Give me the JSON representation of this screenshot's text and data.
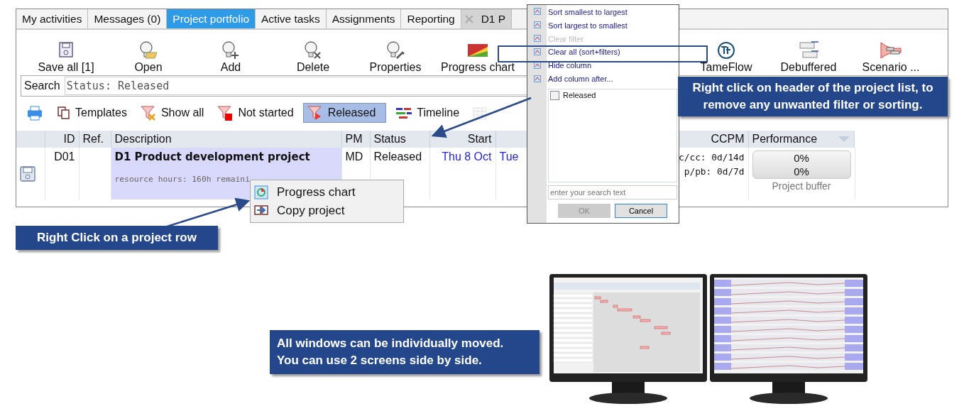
{
  "tabs": [
    {
      "label": "My activities",
      "selected": false,
      "closable": false
    },
    {
      "label": "Messages (0)",
      "selected": false,
      "closable": false
    },
    {
      "label": "Project portfolio",
      "selected": true,
      "closable": false
    },
    {
      "label": "Active tasks",
      "selected": false,
      "closable": false
    },
    {
      "label": "Assignments",
      "selected": false,
      "closable": false
    },
    {
      "label": "Reporting",
      "selected": false,
      "closable": false
    },
    {
      "label": "D1 P",
      "selected": false,
      "closable": true
    }
  ],
  "toolbar": {
    "left": [
      {
        "label": "Save all [1]",
        "kind": "save"
      },
      {
        "label": "Open",
        "kind": "open"
      },
      {
        "label": "Add",
        "kind": "add"
      },
      {
        "label": "Delete",
        "kind": "delete"
      },
      {
        "label": "Properties",
        "kind": "properties"
      },
      {
        "label": "Progress chart",
        "kind": "progress"
      }
    ],
    "right": [
      {
        "label": "TameFlow",
        "kind": "tameflow"
      },
      {
        "label": "Debuffered",
        "kind": "debuffered"
      },
      {
        "label": "Scenario ...",
        "kind": "scenario"
      }
    ]
  },
  "search": {
    "label": "Search",
    "value": "Status: Released"
  },
  "filters": [
    {
      "kind": "print",
      "selected": false,
      "disabled": false
    },
    {
      "kind": "templates",
      "label": "Templates",
      "selected": false,
      "disabled": false
    },
    {
      "kind": "show_all",
      "label": "Show all",
      "selected": false,
      "disabled": false
    },
    {
      "kind": "not_started",
      "label": "Not started",
      "selected": false,
      "disabled": false
    },
    {
      "kind": "released",
      "label": "Released",
      "selected": true,
      "disabled": false
    },
    {
      "kind": "timeline",
      "label": "Timeline",
      "selected": false,
      "disabled": false
    },
    {
      "kind": "calendar",
      "selected": false,
      "disabled": true
    }
  ],
  "table": {
    "columns": [
      {
        "label": "ID",
        "dropdown": false
      },
      {
        "label": "Ref.",
        "dropdown": false
      },
      {
        "label": "Description",
        "dropdown": false
      },
      {
        "label": "PM",
        "dropdown": false
      },
      {
        "label": "Status",
        "dropdown": false
      },
      {
        "label": "Start",
        "dropdown": false
      },
      {
        "label": "CCPM",
        "dropdown": false
      },
      {
        "label": "Performance",
        "dropdown": true
      }
    ],
    "rows": [
      {
        "id": "D01",
        "title": "D1 Product development project",
        "detail": "resource hours: 160h remaini",
        "pm": "MD",
        "status": "Released",
        "start": "Thu 8 Oct",
        "column_8": "Tue",
        "ccpm": [
          "c/cc: 0d/14d",
          "p/pb: 0d/7d"
        ],
        "performance": {
          "values": [
            "0%",
            "0%"
          ],
          "caption": "Project buffer"
        }
      }
    ]
  },
  "column_menu": {
    "items": [
      {
        "label": "Sort smallest to largest",
        "disabled": false
      },
      {
        "label": "Sort largest to smallest",
        "disabled": false
      },
      {
        "label": "Clear filter",
        "disabled": true
      },
      {
        "label": "Clear all (sort+filters)",
        "disabled": false
      },
      {
        "label": "Hide column",
        "disabled": false
      },
      {
        "label": "Add column after...",
        "disabled": false
      }
    ],
    "values": [
      {
        "label": "Released",
        "checked": false
      }
    ],
    "search_placeholder": "enter your search text",
    "buttons": [
      {
        "label": "OK",
        "disabled": true
      },
      {
        "label": "Cancel",
        "disabled": false
      }
    ]
  },
  "context_menu": [
    {
      "label": "Progress chart",
      "kind": "chart"
    },
    {
      "label": "Copy project",
      "kind": "copy"
    }
  ],
  "callouts": [
    {
      "lines": [
        "Right click on header of the project list, to",
        "remove any unwanted filter or sorting."
      ]
    },
    {
      "lines": [
        "Right Click on a project row"
      ]
    },
    {
      "lines": [
        "All windows can be individually moved.",
        "You can use 2 screens side by side."
      ]
    }
  ]
}
